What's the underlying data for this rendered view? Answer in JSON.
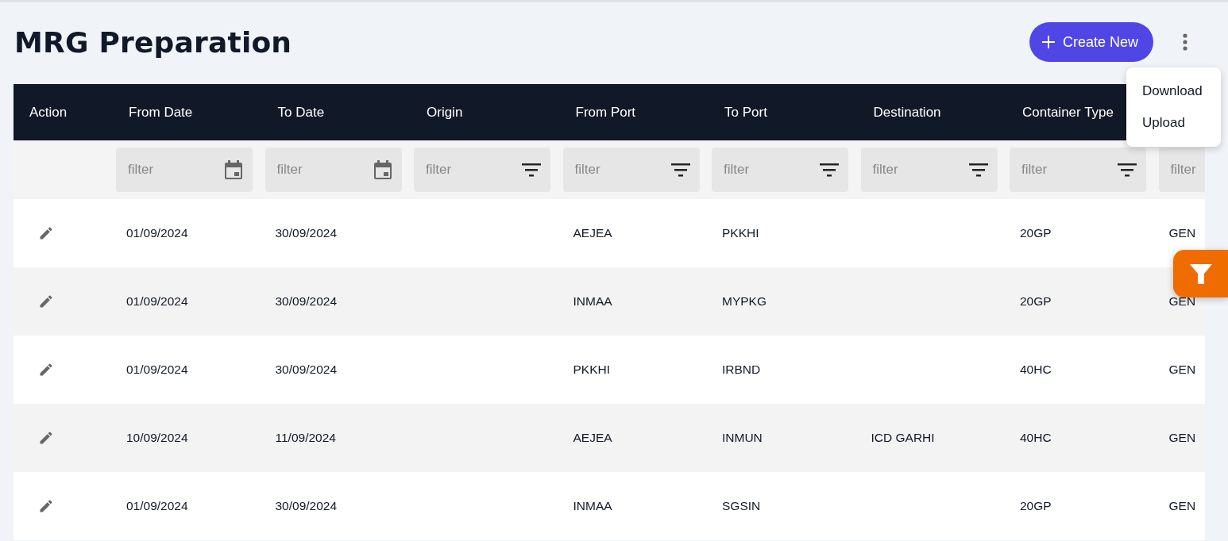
{
  "page": {
    "title": "MRG Preparation"
  },
  "create_button": {
    "label": "Create New"
  },
  "menu": {
    "items": [
      {
        "label": "Download"
      },
      {
        "label": "Upload"
      }
    ]
  },
  "table": {
    "columns": [
      {
        "label": "Action",
        "kind": "action"
      },
      {
        "label": "From Date",
        "filter": {
          "kind": "date",
          "placeholder": "filter"
        }
      },
      {
        "label": "To Date",
        "filter": {
          "kind": "date",
          "placeholder": "filter"
        }
      },
      {
        "label": "Origin",
        "filter": {
          "kind": "text",
          "placeholder": "filter"
        }
      },
      {
        "label": "From Port",
        "filter": {
          "kind": "text",
          "placeholder": "filter"
        }
      },
      {
        "label": "To Port",
        "filter": {
          "kind": "text",
          "placeholder": "filter"
        }
      },
      {
        "label": "Destination",
        "filter": {
          "kind": "text",
          "placeholder": "filter"
        }
      },
      {
        "label": "Container Type",
        "filter": {
          "kind": "text",
          "placeholder": "filter"
        }
      },
      {
        "filter": {
          "kind": "plain",
          "placeholder": "filter"
        }
      }
    ],
    "rows": [
      {
        "cells": [
          "",
          "01/09/2024",
          "30/09/2024",
          "",
          "AEJEA",
          "PKKHI",
          "",
          "20GP",
          "GEN"
        ]
      },
      {
        "cells": [
          "",
          "01/09/2024",
          "30/09/2024",
          "",
          "INMAA",
          "MYPKG",
          "",
          "20GP",
          "GEN"
        ]
      },
      {
        "cells": [
          "",
          "01/09/2024",
          "30/09/2024",
          "",
          "PKKHI",
          "IRBND",
          "",
          "40HC",
          "GEN"
        ]
      },
      {
        "cells": [
          "",
          "10/09/2024",
          "11/09/2024",
          "",
          "AEJEA",
          "INMUN",
          "ICD GARHI",
          "40HC",
          "GEN"
        ]
      },
      {
        "cells": [
          "",
          "01/09/2024",
          "30/09/2024",
          "",
          "INMAA",
          "SGSIN",
          "",
          "20GP",
          "GEN"
        ]
      }
    ]
  }
}
